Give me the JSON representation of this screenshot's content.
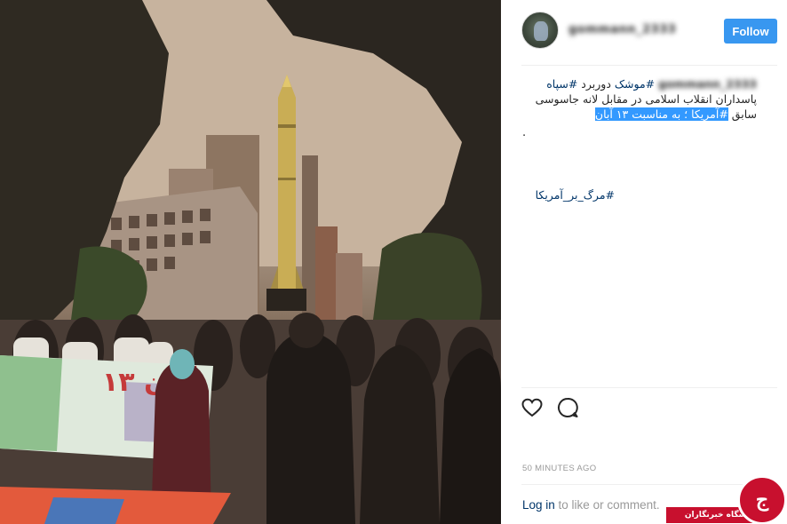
{
  "header": {
    "username": "gommann_2333",
    "follow_label": "Follow"
  },
  "caption": {
    "username": "gommann_2333",
    "tag1": "#موشک",
    "text1": " دوربرد ",
    "tag2": "#سپاه",
    "text2": " پاسداران انقلاب اسلامی در مقابل لانه جاسوسی سابق ",
    "tag3": "#آمریکا",
    "text3": " ؛ به مناسبت ۱۳ آبان",
    "dot": ".",
    "tag4": "#مرگ_بر_آمریکا"
  },
  "post": {
    "time": "50 MINUTES AGO",
    "login_link": "Log in",
    "login_rest": " to like or comment."
  },
  "photo": {
    "banner_text": "۱۳ آبان"
  },
  "watermark": {
    "name": "باشگاه خبرنگاران",
    "logo_letter": "ج"
  },
  "icons": [
    "heart-icon",
    "comment-icon"
  ],
  "colors": {
    "follow": "#3897f0",
    "link": "#003569",
    "highlight": "#3399ff",
    "watermark": "#c8102e"
  }
}
